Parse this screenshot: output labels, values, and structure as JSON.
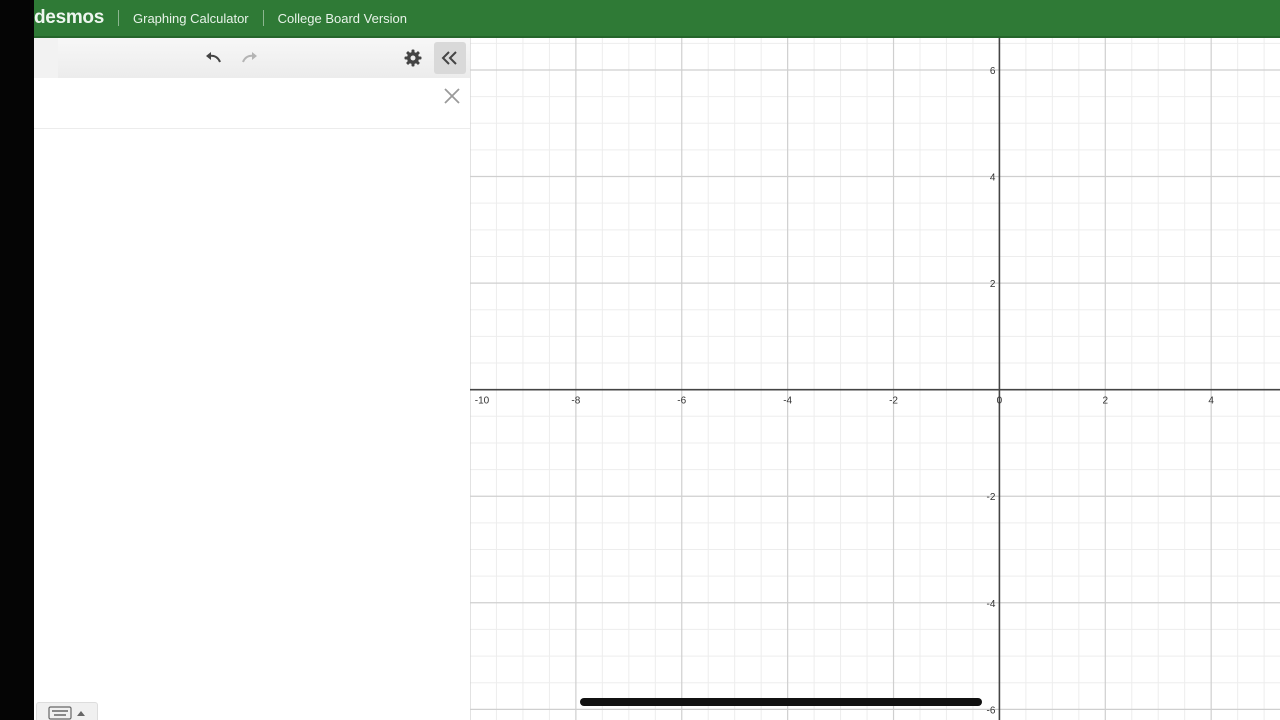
{
  "header": {
    "logo": "desmos",
    "items": [
      "Graphing Calculator",
      "College Board Version"
    ],
    "color": "#2f7a36"
  },
  "toolbar": {
    "add_icon": "plus-icon",
    "undo_icon": "undo-icon",
    "redo_icon": "redo-icon",
    "settings_icon": "gear-icon",
    "collapse_icon": "double-chevron-left-icon"
  },
  "expression_list": {
    "rows": [
      {
        "value": ""
      }
    ],
    "delete_icon": "close-icon"
  },
  "keypad_toggle": {
    "icon": "keyboard-icon"
  },
  "graph": {
    "x_ticks": [
      "-10",
      "-8",
      "-6",
      "-4",
      "-2",
      "0",
      "2",
      "4"
    ],
    "y_ticks_pos": [
      "6",
      "4",
      "2"
    ],
    "y_ticks_neg": [
      "-2",
      "-4",
      "-6"
    ],
    "x_range": [
      -10,
      5.3
    ],
    "y_range": [
      -6.2,
      6.6
    ],
    "grid": true
  }
}
